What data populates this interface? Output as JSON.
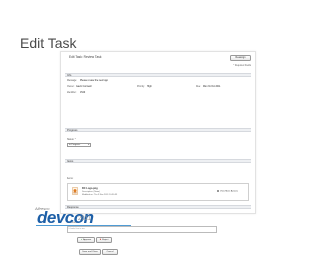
{
  "slide": {
    "title": "Edit Task"
  },
  "task": {
    "title": "Edit Task: Review Task",
    "reassign_label": "Reassign",
    "required_note": "* Required Fields"
  },
  "info": {
    "heading": "Info",
    "message_label": "Message:",
    "message_value": "Please review the new logo",
    "owner_label": "Owner:",
    "owner_value": "Gavin Cornwell",
    "priority_label": "Priority:",
    "priority_value": "High",
    "due_label": "Due:",
    "due_value": "Mon 31 Oct 2011",
    "identifier_label": "Identifier:",
    "identifier_value": "1540"
  },
  "progress": {
    "heading": "Progress",
    "status_label": "Status: *",
    "status_value": "In Progress"
  },
  "items": {
    "heading": "Items",
    "label": "Items:",
    "item_name": "DC Logo.png",
    "item_description": "Description: (None)",
    "item_modified": "Modified on: Thu 3 Nov 2011 10:30:33",
    "view_more_actions": "View More Actions"
  },
  "response": {
    "heading": "Response",
    "comment_label": "Comment:",
    "comment_value": "It looks fine to me",
    "approve_label": "Approve",
    "reject_label": "Reject",
    "save_label": "Save and Close",
    "cancel_label": "Cancel"
  },
  "branding": {
    "logo_text": "Alfresco",
    "logo_main": "devcon",
    "logo_year": "2011",
    "colors": {
      "brand_blue": "#1d5fa7",
      "accent_orange": "#e07b1f"
    }
  }
}
